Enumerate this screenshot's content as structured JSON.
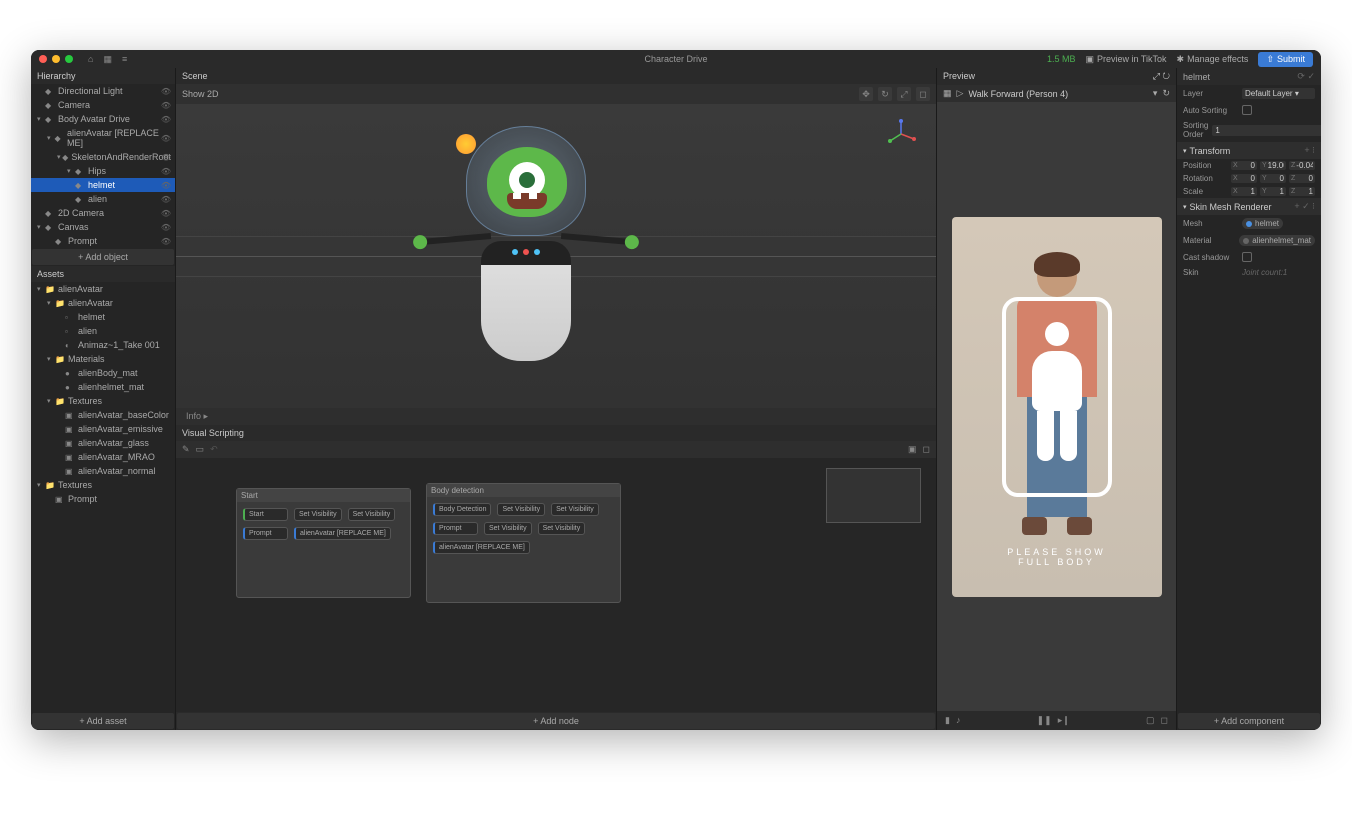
{
  "titlebar": {
    "title": "Character Drive",
    "size": "1.5 MB",
    "preview_btn": "Preview in TikTok",
    "manage_btn": "Manage effects",
    "submit_btn": "Submit"
  },
  "hierarchy": {
    "title": "Hierarchy",
    "add_label": "+ Add object",
    "items": [
      {
        "label": "Directional Light",
        "indent": 0,
        "expandable": false
      },
      {
        "label": "Camera",
        "indent": 0,
        "expandable": false
      },
      {
        "label": "Body Avatar Drive",
        "indent": 0,
        "expandable": true
      },
      {
        "label": "alienAvatar [REPLACE ME]",
        "indent": 1,
        "expandable": true
      },
      {
        "label": "SkeletonAndRenderRoot",
        "indent": 2,
        "expandable": true
      },
      {
        "label": "Hips",
        "indent": 3,
        "expandable": true
      },
      {
        "label": "helmet",
        "indent": 3,
        "expandable": false,
        "selected": true
      },
      {
        "label": "alien",
        "indent": 3,
        "expandable": false
      },
      {
        "label": "2D Camera",
        "indent": 0,
        "expandable": false
      },
      {
        "label": "Canvas",
        "indent": 0,
        "expandable": true
      },
      {
        "label": "Prompt",
        "indent": 1,
        "expandable": false
      }
    ]
  },
  "assets": {
    "title": "Assets",
    "add_label": "+ Add asset",
    "items": [
      {
        "label": "alienAvatar",
        "indent": 0,
        "type": "folder",
        "open": true
      },
      {
        "label": "alienAvatar",
        "indent": 1,
        "type": "folder",
        "open": true
      },
      {
        "label": "helmet",
        "indent": 2,
        "type": "mesh"
      },
      {
        "label": "alien",
        "indent": 2,
        "type": "mesh"
      },
      {
        "label": "Animaz~1_Take 001",
        "indent": 2,
        "type": "anim"
      },
      {
        "label": "Materials",
        "indent": 1,
        "type": "folder",
        "open": true
      },
      {
        "label": "alienBody_mat",
        "indent": 2,
        "type": "mat"
      },
      {
        "label": "alienhelmet_mat",
        "indent": 2,
        "type": "mat"
      },
      {
        "label": "Textures",
        "indent": 1,
        "type": "folder",
        "open": true
      },
      {
        "label": "alienAvatar_baseColor",
        "indent": 2,
        "type": "tex"
      },
      {
        "label": "alienAvatar_emissive",
        "indent": 2,
        "type": "tex"
      },
      {
        "label": "alienAvatar_glass",
        "indent": 2,
        "type": "tex"
      },
      {
        "label": "alienAvatar_MRAO",
        "indent": 2,
        "type": "tex"
      },
      {
        "label": "alienAvatar_normal",
        "indent": 2,
        "type": "tex"
      },
      {
        "label": "Textures",
        "indent": 0,
        "type": "folder",
        "open": true
      },
      {
        "label": "Prompt",
        "indent": 1,
        "type": "tex"
      }
    ]
  },
  "scene": {
    "title": "Scene",
    "show2d": "Show 2D",
    "info": "Info"
  },
  "vs": {
    "title": "Visual Scripting",
    "add_node": "+ Add node",
    "groups": [
      {
        "title": "Start",
        "nodes": [
          "Start",
          "Set Visibility",
          "Set Visibility",
          "Prompt",
          "alienAvatar [REPLACE ME]"
        ]
      },
      {
        "title": "Body detection",
        "nodes": [
          "Body Detection",
          "Set Visibility",
          "Set Visibility",
          "Prompt",
          "Set Visibility",
          "Set Visibility",
          "alienAvatar [REPLACE ME]"
        ]
      }
    ]
  },
  "preview": {
    "title": "Preview",
    "animation": "Walk Forward (Person 4)",
    "overlay_line1": "PLEASE SHOW",
    "overlay_line2": "FULL BODY"
  },
  "inspector": {
    "object_name": "helmet",
    "layer_label": "Layer",
    "layer_value": "Default Layer",
    "auto_sorting": "Auto Sorting",
    "sorting_order_label": "Sorting Order",
    "sorting_order_value": "1",
    "transform": {
      "title": "Transform",
      "position_label": "Position",
      "position": {
        "x": "0",
        "y": "19.00",
        "z": "-0.04"
      },
      "rotation_label": "Rotation",
      "rotation": {
        "x": "0",
        "y": "0",
        "z": "0"
      },
      "scale_label": "Scale",
      "scale": {
        "x": "1",
        "y": "1",
        "z": "1"
      }
    },
    "renderer": {
      "title": "Skin Mesh Renderer",
      "mesh_label": "Mesh",
      "mesh_value": "helmet",
      "material_label": "Material",
      "material_value": "alienhelmet_mat",
      "cast_shadow": "Cast shadow",
      "skin_label": "Skin",
      "skin_value": "Joint count:1"
    },
    "add_component": "+ Add component"
  }
}
